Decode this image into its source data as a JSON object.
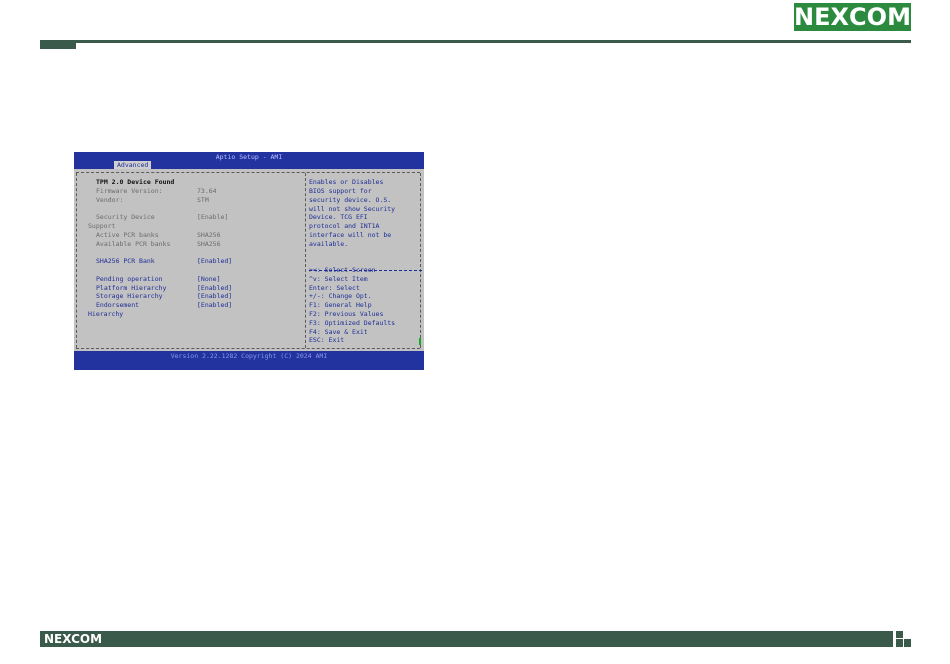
{
  "brand": {
    "logo_text_a": "NE",
    "logo_text_x": "X",
    "logo_text_b": "COM",
    "footer_logo": "NEXCOM",
    "green": "#2b8a3e",
    "bar": "#3a5a4c"
  },
  "bios": {
    "title": "Aptio Setup - AMI",
    "tab": "Advanced",
    "footer": "Version 2.22.1282 Copyright (C) 2024 AMI",
    "settings": [
      {
        "label": "TPM 2.0 Device Found",
        "value": ""
      },
      {
        "label": "Firmware Version:",
        "value": "73.64"
      },
      {
        "label": "Vendor:",
        "value": "STM"
      },
      {
        "label": "Security Device",
        "value": "[Enable]"
      },
      {
        "label": "Support",
        "value": ""
      },
      {
        "label": "Active PCR banks",
        "value": "SHA256"
      },
      {
        "label": "Available PCR banks",
        "value": "SHA256"
      },
      {
        "label": "SHA256 PCR Bank",
        "value": "[Enabled]"
      },
      {
        "label": "Pending operation",
        "value": "[None]"
      },
      {
        "label": "Platform Hierarchy",
        "value": "[Enabled]"
      },
      {
        "label": "Storage Hierarchy",
        "value": "[Enabled]"
      },
      {
        "label": "Endorsement",
        "value": "[Enabled]"
      },
      {
        "label": "Hierarchy",
        "value": ""
      }
    ],
    "help": {
      "lines": [
        "Enables or Disables",
        "BIOS support for",
        "security device. O.S.",
        "will not show Security",
        "Device. TCG EFI",
        "protocol and INT1A",
        "interface will not be",
        "available."
      ],
      "keys": [
        "><: Select Screen",
        "^v: Select Item",
        "Enter: Select",
        "+/-: Change Opt.",
        "F1: General Help",
        "F2: Previous Values",
        "F3: Optimized Defaults",
        "F4: Save & Exit",
        "ESC: Exit"
      ]
    }
  }
}
